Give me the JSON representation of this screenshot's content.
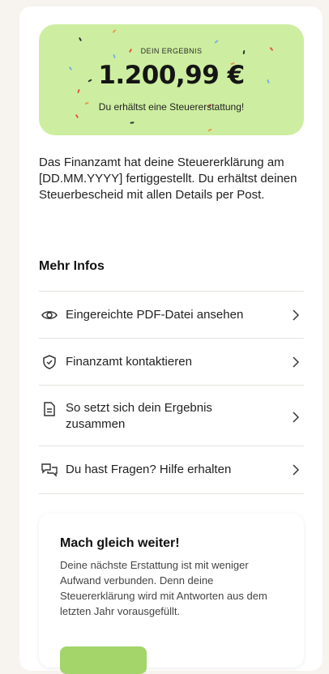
{
  "result": {
    "kicker": "DEIN ERGEBNIS",
    "amount": "1.200,99 €",
    "subtitle": "Du erhältst eine Steuererstattung!",
    "bg_color": "#cdeea0"
  },
  "description": "Das Finanzamt hat deine Steuererklärung am [DD.MM.YYYY] fertiggestellt. Du erhältst deinen Steuerbescheid mit allen Details per Post.",
  "more_info": {
    "title": "Mehr Infos",
    "items": [
      {
        "icon": "eye-icon",
        "label": "Eingereichte PDF-Datei ansehen"
      },
      {
        "icon": "shield-check-icon",
        "label": "Finanzamt kontaktieren"
      },
      {
        "icon": "document-icon",
        "label": "So setzt sich dein Ergebnis zusammen"
      },
      {
        "icon": "chat-bubbles-icon",
        "label": "Du hast Fragen? Hilfe erhalten"
      }
    ]
  },
  "cta": {
    "title": "Mach gleich weiter!",
    "text": "Deine nächste Erstattung ist mit weniger Aufwand verbunden. Denn deine Steuererklärung wird mit Antworten aus dem letzten Jahr vorausgefüllt.",
    "button_color": "#a3d56a"
  }
}
